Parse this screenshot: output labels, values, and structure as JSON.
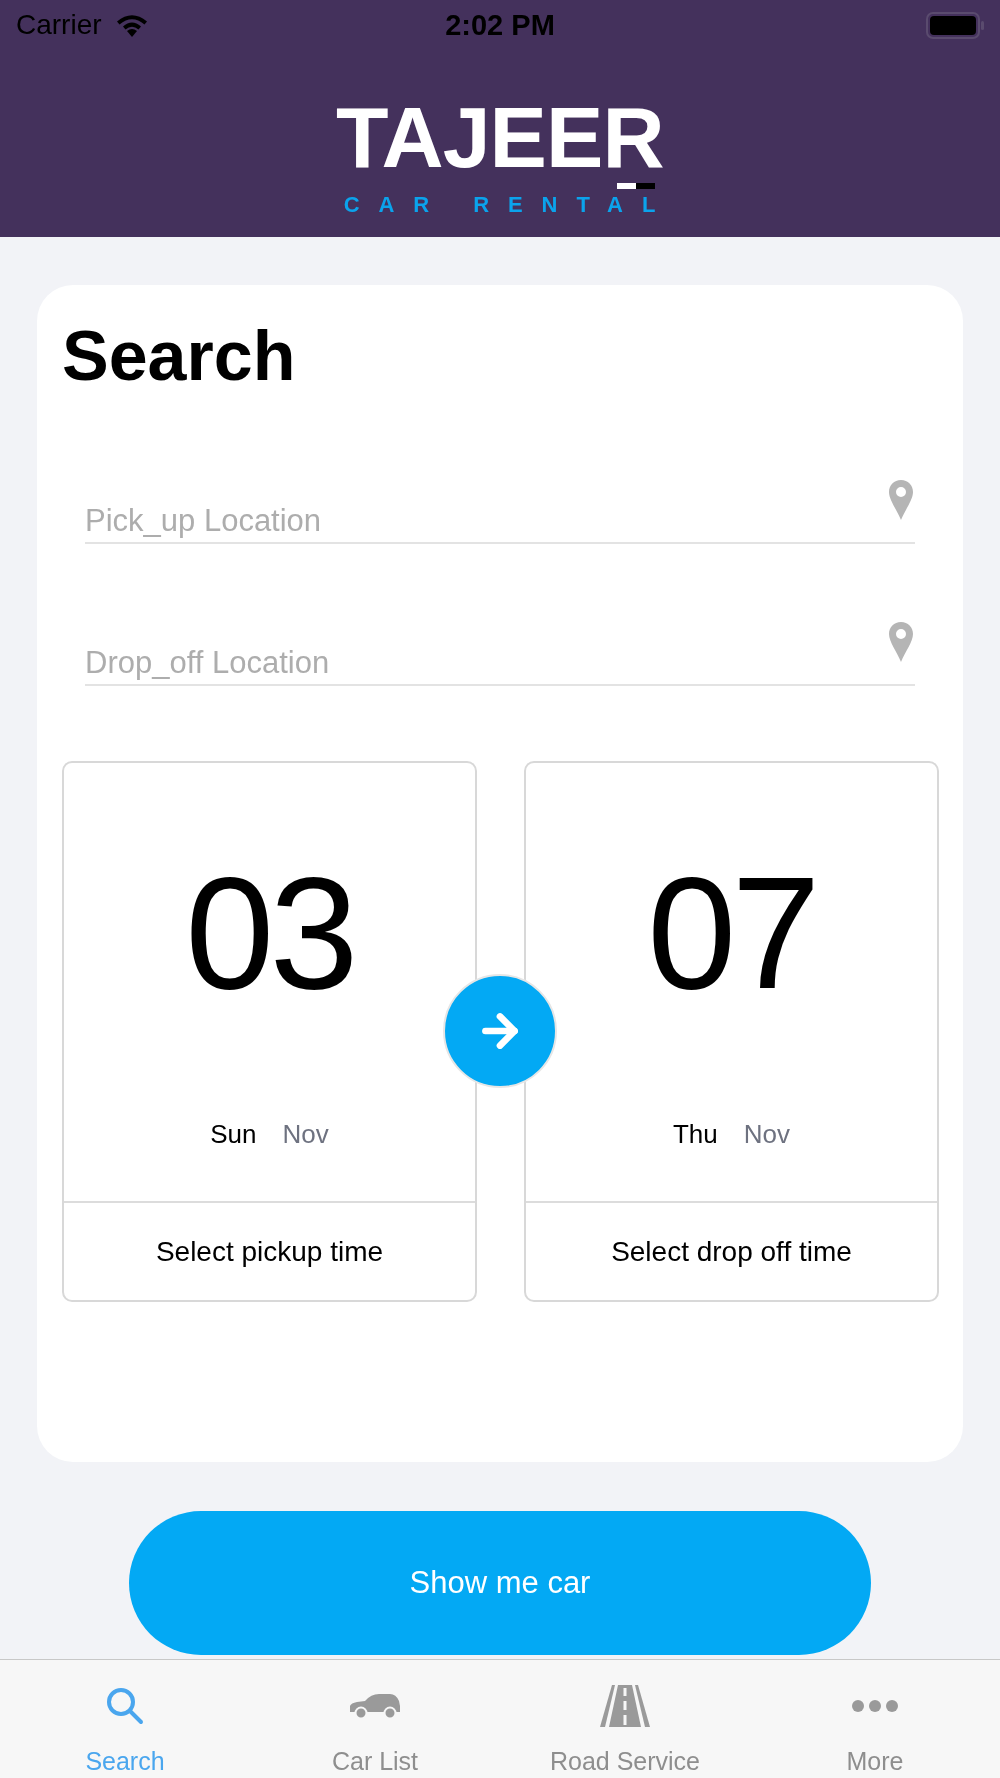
{
  "status_bar": {
    "carrier": "Carrier",
    "time": "2:02 PM"
  },
  "header": {
    "logo_title": "TAJEER",
    "logo_subtitle": "CAR RENTAL"
  },
  "search_card": {
    "title": "Search",
    "location_fields": [
      {
        "placeholder": "Pick_up Location"
      },
      {
        "placeholder": "Drop_off Location"
      }
    ],
    "date_cards": [
      {
        "day": "03",
        "weekday": "Sun",
        "month": "Nov",
        "action": "Select pickup time"
      },
      {
        "day": "07",
        "weekday": "Thu",
        "month": "Nov",
        "action": "Select drop off time"
      }
    ]
  },
  "show_button": {
    "label": "Show me car"
  },
  "tab_bar": [
    {
      "kind": "search",
      "label": "Search",
      "selected": true
    },
    {
      "kind": "car",
      "label": "Car List",
      "selected": false
    },
    {
      "kind": "road",
      "label": "Road Service",
      "selected": false
    },
    {
      "kind": "more",
      "label": "More",
      "selected": false
    }
  ]
}
